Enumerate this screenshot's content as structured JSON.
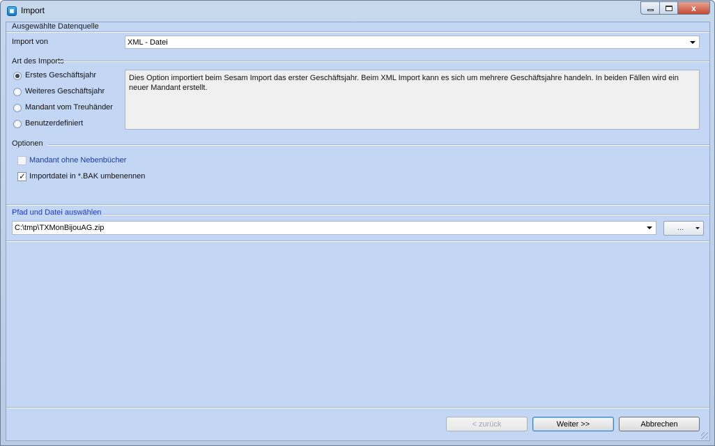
{
  "window": {
    "title": "Import",
    "icon": "import-app-icon",
    "controls": {
      "minimize": "minimize-icon",
      "maximize": "maximize-icon",
      "close": "x"
    }
  },
  "datasource": {
    "group_title": "Ausgewählte Datenquelle",
    "import_label": "Import von",
    "import_value": "XML - Datei"
  },
  "import_type": {
    "group_title": "Art des Imports",
    "options": [
      {
        "label": "Erstes Geschäftsjahr",
        "checked": true
      },
      {
        "label": "Weiteres Geschäftsjahr",
        "checked": false
      },
      {
        "label": "Mandant vom Treuhänder",
        "checked": false
      },
      {
        "label": "Benutzerdefiniert",
        "checked": false
      }
    ],
    "description": "Dies Option importiert beim Sesam Import das erster Geschäftsjahr. Beim XML Import kann es sich um mehrere Geschäftsjahre handeln. In beiden Fällen wird ein neuer Mandant erstellt."
  },
  "options": {
    "group_title": "Optionen",
    "items": [
      {
        "label": "Mandant ohne Nebenbücher",
        "checked": false,
        "enabled": false
      },
      {
        "label": "Importdatei in *.BAK umbenennen",
        "checked": true,
        "enabled": true
      }
    ]
  },
  "path": {
    "group_title": "Pfad und Datei auswählen",
    "value": "C:\\tmp\\TXMonBijouAG.zip",
    "browse_label": "..."
  },
  "buttons": {
    "back": "< zurück",
    "next": "Weiter >>",
    "cancel": "Abbrechen"
  },
  "colors": {
    "client_bg": "#c3d7f4",
    "link_blue": "#1a35d6",
    "close_red": "#c54a33"
  }
}
